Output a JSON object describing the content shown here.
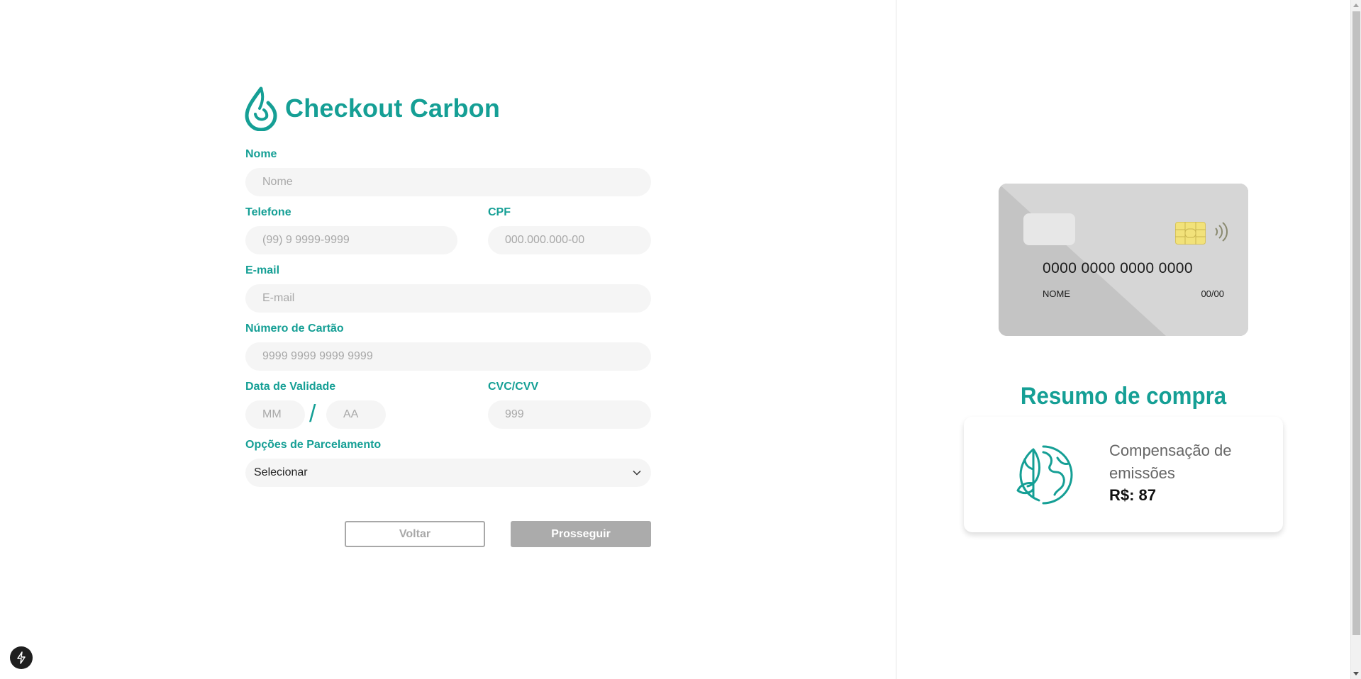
{
  "brand": {
    "title": "Checkout Carbon",
    "logo_icon": "drop-logo-icon",
    "accent": "#159f95"
  },
  "form": {
    "nome": {
      "label": "Nome",
      "placeholder": "Nome",
      "value": ""
    },
    "telefone": {
      "label": "Telefone",
      "placeholder": "(99) 9 9999-9999",
      "value": ""
    },
    "cpf": {
      "label": "CPF",
      "placeholder": "000.000.000-00",
      "value": ""
    },
    "email": {
      "label": "E-mail",
      "placeholder": "E-mail",
      "value": ""
    },
    "cartao": {
      "label": "Número de Cartão",
      "placeholder": "9999 9999 9999 9999",
      "value": ""
    },
    "validade": {
      "label": "Data de Validade",
      "mes_placeholder": "MM",
      "ano_placeholder": "AA",
      "separator": "/"
    },
    "cvc": {
      "label": "CVC/CVV",
      "placeholder": "999",
      "value": ""
    },
    "parcelamento": {
      "label": "Opções de Parcelamento",
      "selected": "Selecionar"
    }
  },
  "buttons": {
    "back": "Voltar",
    "next": "Prosseguir"
  },
  "card": {
    "number": "0000 0000 0000 0000",
    "name": "NOME",
    "expiry": "00/00"
  },
  "summary": {
    "title": "Resumo de compra",
    "item": "Compensação de emissões",
    "price": "R$: 87",
    "icon": "leaf-globe-icon"
  }
}
